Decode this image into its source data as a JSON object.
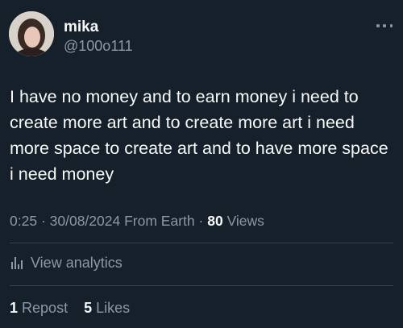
{
  "author": {
    "name": "mika",
    "handle": "@100o111"
  },
  "tweet": {
    "text": "I have no money and to earn money i need to create more art and to create more art i need more space to create art and to have more space i need money"
  },
  "meta": {
    "time": "0:25",
    "date": "30/08/2024",
    "source": "From Earth",
    "views_count": "80",
    "views_label": "Views"
  },
  "analytics": {
    "label": "View analytics"
  },
  "stats": {
    "reposts_count": "1",
    "reposts_label": "Repost",
    "likes_count": "5",
    "likes_label": "Likes"
  },
  "icons": {
    "more": "more-horizontal-icon",
    "analytics": "bar-chart-icon"
  },
  "colors": {
    "background": "#15202b",
    "text_primary": "#f7f9f9",
    "text_secondary": "#8b98a5",
    "divider": "#38444d"
  }
}
